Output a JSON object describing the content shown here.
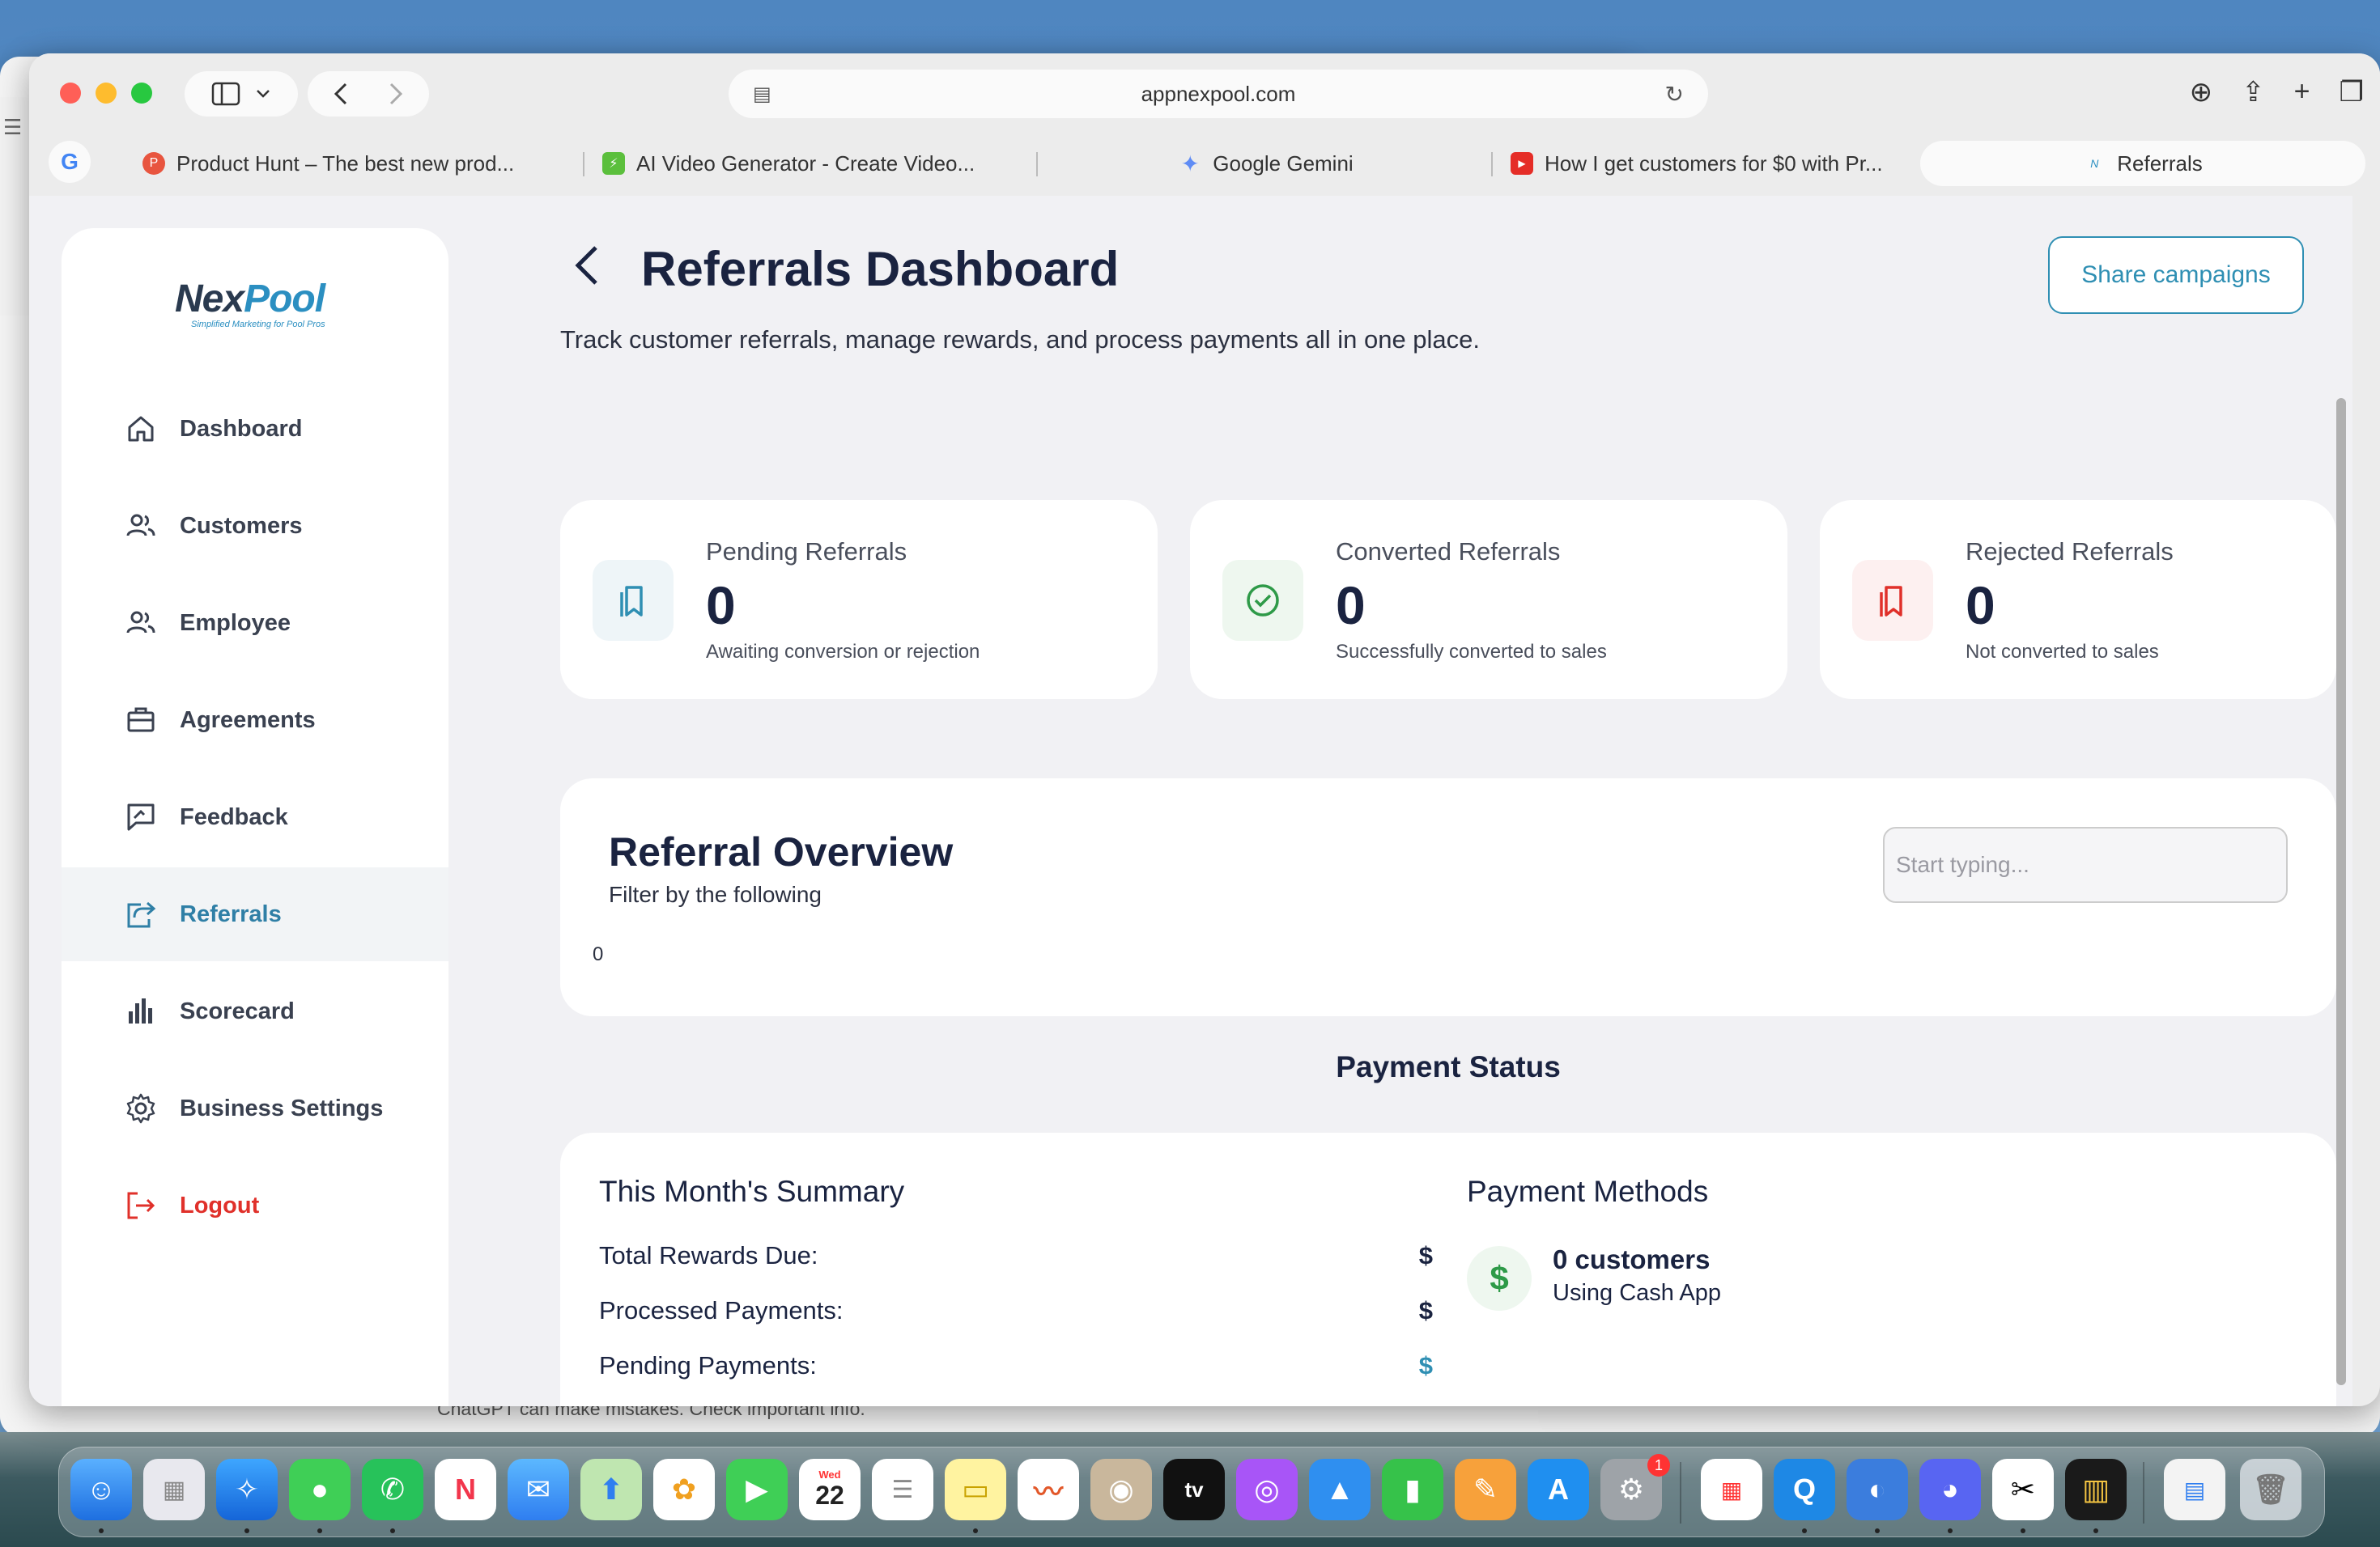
{
  "browser": {
    "url": "appnexpool.com",
    "tabs": [
      {
        "title": "Product Hunt – The best new prod...",
        "favicon_color": "#e8553f",
        "favicon_glyph": "P"
      },
      {
        "title": "AI Video Generator - Create Video...",
        "favicon_color": "#5bbf3c",
        "favicon_glyph": "⚡"
      },
      {
        "title": "Google Gemini",
        "favicon_color": "#5f8cf5",
        "favicon_glyph": "✦"
      },
      {
        "title": "How I get customers for $0 with Pr...",
        "favicon_color": "#e52d27",
        "favicon_glyph": "▶"
      },
      {
        "title": "Referrals",
        "favicon_color": "#2b8fc1",
        "favicon_glyph": "N"
      }
    ]
  },
  "sidebar": {
    "logo_brand_a": "Nex",
    "logo_brand_b": "Pool",
    "logo_tagline": "Simplified Marketing for Pool Pros",
    "items": [
      {
        "label": "Dashboard",
        "icon": "home-icon"
      },
      {
        "label": "Customers",
        "icon": "users-icon"
      },
      {
        "label": "Employee",
        "icon": "users-icon"
      },
      {
        "label": "Agreements",
        "icon": "briefcase-icon"
      },
      {
        "label": "Feedback",
        "icon": "feedback-icon"
      },
      {
        "label": "Referrals",
        "icon": "share-icon",
        "active": true
      },
      {
        "label": "Scorecard",
        "icon": "bar-chart-icon"
      },
      {
        "label": "Business Settings",
        "icon": "gear-icon"
      },
      {
        "label": "Logout",
        "icon": "logout-icon"
      }
    ]
  },
  "header": {
    "title": "Referrals Dashboard",
    "subtitle": "Track customer referrals, manage rewards, and process payments all in one place.",
    "share_label": "Share campaigns"
  },
  "stats": [
    {
      "label": "Pending Referrals",
      "value": "0",
      "desc": "Awaiting conversion or rejection",
      "color": "#2f8fb3",
      "bg": "#eef5f8"
    },
    {
      "label": "Converted Referrals",
      "value": "0",
      "desc": "Successfully converted to sales",
      "color": "#2e9a48",
      "bg": "#eef7ef"
    },
    {
      "label": "Rejected Referrals",
      "value": "0",
      "desc": "Not converted to sales",
      "color": "#e0302a",
      "bg": "#fdf0f0"
    }
  ],
  "overview": {
    "title": "Referral Overview",
    "subtitle": "Filter by the following",
    "count": "0",
    "search_placeholder": "Start typing..."
  },
  "payment_status": {
    "heading": "Payment Status",
    "summary_title": "This Month's Summary",
    "rows": [
      {
        "label": "Total Rewards Due:",
        "value": "$"
      },
      {
        "label": "Processed Payments:",
        "value": "$"
      },
      {
        "label": "Pending Payments:",
        "value": "$"
      }
    ],
    "methods_title": "Payment Methods",
    "method_count": "0 customers",
    "method_sub": "Using Cash App"
  },
  "background": {
    "chatgpt_note": "ChatGPT can make mistakes. Check important info."
  },
  "dock": {
    "calendar_day": "Wed",
    "calendar_date": "22",
    "settings_badge": "1"
  }
}
